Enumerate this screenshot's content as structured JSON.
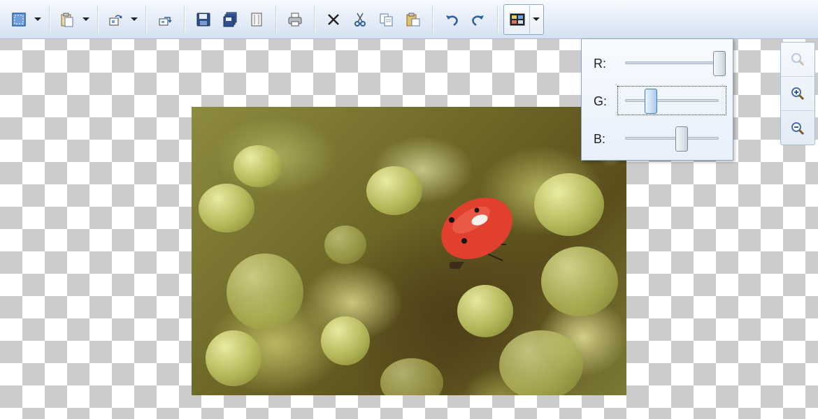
{
  "toolbar": {
    "buttons": [
      {
        "name": "select-mode",
        "icon": "select-icon",
        "has_dropdown": true
      },
      {
        "name": "paste-as",
        "icon": "clipboard-icon",
        "has_dropdown": true
      },
      {
        "name": "rotate",
        "icon": "rotate-icon",
        "has_dropdown": true
      },
      {
        "name": "flip",
        "icon": "flip-icon",
        "has_dropdown": false
      },
      {
        "name": "save",
        "icon": "save-icon",
        "has_dropdown": false
      },
      {
        "name": "save-all",
        "icon": "save-all-icon",
        "has_dropdown": false
      },
      {
        "name": "page",
        "icon": "page-icon",
        "has_dropdown": false
      },
      {
        "name": "print",
        "icon": "printer-icon",
        "has_dropdown": false
      },
      {
        "name": "delete",
        "icon": "delete-x-icon",
        "has_dropdown": false
      },
      {
        "name": "cut",
        "icon": "scissors-icon",
        "has_dropdown": false
      },
      {
        "name": "copy",
        "icon": "copy-icon",
        "has_dropdown": false
      },
      {
        "name": "paste",
        "icon": "paste-icon",
        "has_dropdown": false
      },
      {
        "name": "undo",
        "icon": "undo-icon",
        "has_dropdown": false
      },
      {
        "name": "redo",
        "icon": "redo-icon",
        "has_dropdown": false
      },
      {
        "name": "color-adjust",
        "icon": "color-balance-icon",
        "has_dropdown": true,
        "pressed": true
      }
    ]
  },
  "color_popup": {
    "r_label": "R:",
    "g_label": "G:",
    "b_label": "B:",
    "r_value": 1.0,
    "g_value": 0.27,
    "b_value": 0.6,
    "focused": "G"
  },
  "zoom_panel": {
    "buttons": [
      "zoom-reset-icon",
      "zoom-in-icon",
      "zoom-out-icon"
    ]
  },
  "colors": {
    "toolbar_accent": "#2a5fa8",
    "checker": "#cccccc"
  }
}
